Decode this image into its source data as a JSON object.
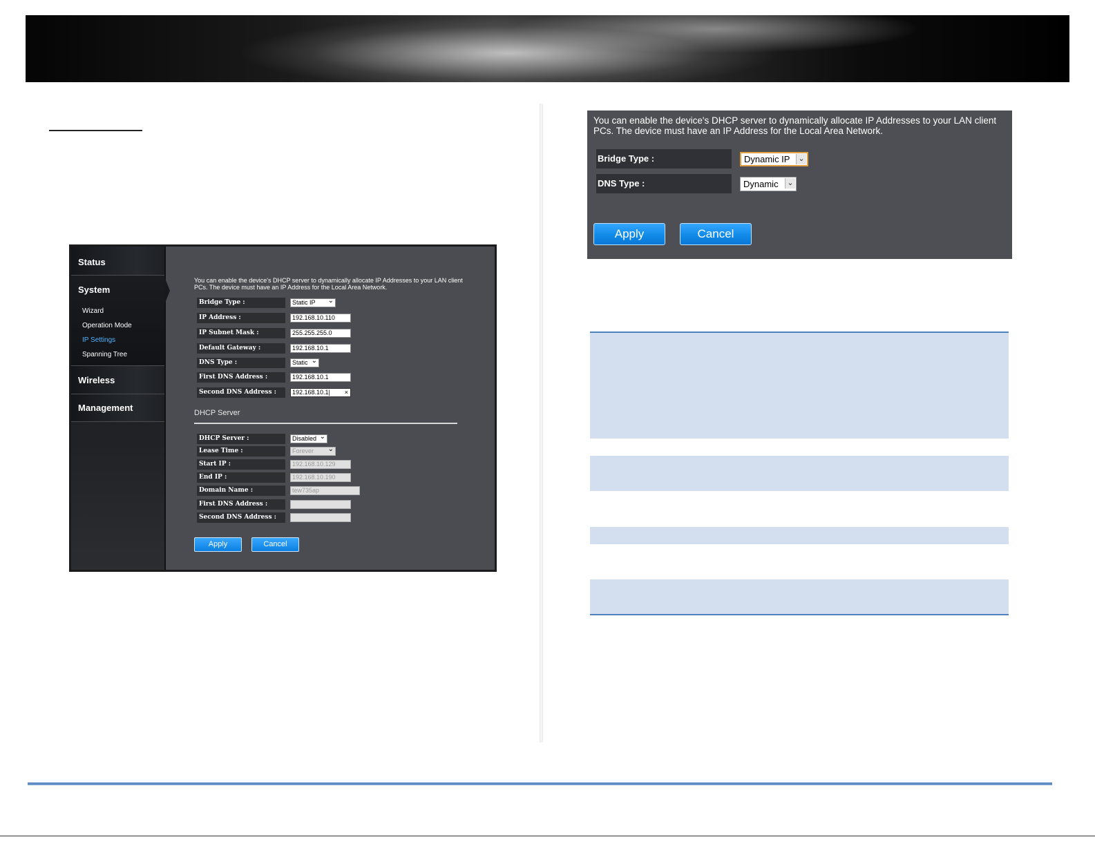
{
  "colors": {
    "panel_bg": "#4a4c51",
    "label_bg": "#2c2e32",
    "button_blue": "#118be8",
    "active_link": "#4fb3ff",
    "table_band": "#d3dfee",
    "rule_blue": "#4f81bd"
  },
  "left_ui": {
    "nav": {
      "status": "Status",
      "system": "System",
      "system_items": [
        "Wizard",
        "Operation Mode",
        "IP Settings",
        "Spanning Tree"
      ],
      "active_item": "IP Settings",
      "wireless": "Wireless",
      "management": "Management"
    },
    "description": "You can enable the device's DHCP server to dynamically allocate IP Addresses to your LAN client PCs. The device must have an IP Address for the Local Area Network.",
    "fields": [
      {
        "label": "Bridge Type :",
        "value": "Static IP"
      },
      {
        "label": "IP Address :",
        "value": "192.168.10.110"
      },
      {
        "label": "IP Subnet Mask :",
        "value": "255.255.255.0"
      },
      {
        "label": "Default Gateway :",
        "value": "192.168.10.1"
      },
      {
        "label": "DNS Type :",
        "value": "Static"
      },
      {
        "label": "First DNS Address :",
        "value": "192.168.10.1"
      },
      {
        "label": "Second DNS Address :",
        "value": "192.168.10.1|"
      }
    ],
    "dhcp_heading": "DHCP Server",
    "dhcp_fields": [
      {
        "label": "DHCP Server :",
        "value": "Disabled"
      },
      {
        "label": "Lease Time :",
        "value": "Forever"
      },
      {
        "label": "Start IP :",
        "value": "192.168.10.129"
      },
      {
        "label": "End IP :",
        "value": "192.168.10.190"
      },
      {
        "label": "Domain Name :",
        "value": "tew735ap"
      },
      {
        "label": "First DNS Address :",
        "value": ""
      },
      {
        "label": "Second DNS Address :",
        "value": ""
      }
    ],
    "apply": "Apply",
    "cancel": "Cancel",
    "clear_symbol": "×"
  },
  "right_ui": {
    "description": "You can enable the device's DHCP server to dynamically allocate IP Addresses to your LAN client PCs. The device must have an IP Address for the Local Area Network.",
    "fields": [
      {
        "label": "Bridge Type :",
        "value": "Dynamic IP"
      },
      {
        "label": "DNS Type :",
        "value": "Dynamic"
      }
    ],
    "apply": "Apply",
    "cancel": "Cancel"
  },
  "icons": {
    "dropdown_arrow": "chevron-down-icon",
    "clear": "close-icon"
  }
}
